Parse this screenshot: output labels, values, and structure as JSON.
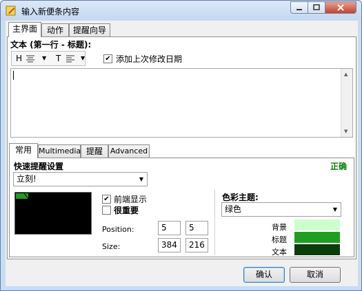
{
  "window": {
    "title": "输入新便条内容"
  },
  "top_tabs": [
    {
      "label": "主界面",
      "active": true
    },
    {
      "label": "动作",
      "active": false
    },
    {
      "label": "提醒向导",
      "active": false
    }
  ],
  "text_section": {
    "label": "文本 (第一行 - 标题):",
    "toolbar": {
      "heading_label": "H",
      "text_label": "T"
    },
    "append_date_label": "添加上次修改日期",
    "append_date_checked": true,
    "body_value": ""
  },
  "bottom_tabs": [
    {
      "label": "常用",
      "active": true
    },
    {
      "label": "Multimedia",
      "active": false
    },
    {
      "label": "提醒",
      "active": false
    },
    {
      "label": "Advanced",
      "active": false
    }
  ],
  "common": {
    "quick_reminder_label": "快速提醒设置",
    "status": "正确",
    "status_color": "#008000",
    "quick_reminder_value": "立刻!",
    "foreground_label": "前端显示",
    "foreground_checked": true,
    "important_label": "很重要",
    "important_checked": false,
    "position_label": "Position:",
    "position_x": "5",
    "position_y": "5",
    "size_label": "Size:",
    "size_w": "384",
    "size_h": "216"
  },
  "color_theme": {
    "label": "色彩主题:",
    "value": "绿色",
    "rows": [
      {
        "label": "背景",
        "color": "#ccffcc"
      },
      {
        "label": "标题",
        "color": "#1f9f1f"
      },
      {
        "label": "文本",
        "color": "#0b3d0b"
      }
    ]
  },
  "buttons": {
    "ok": "确认",
    "cancel": "取消"
  }
}
